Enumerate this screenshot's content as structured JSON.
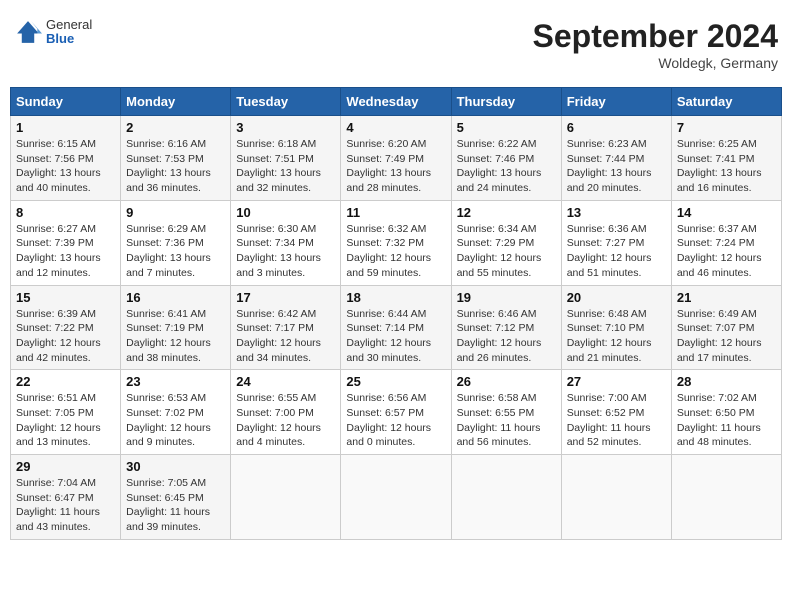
{
  "header": {
    "logo": {
      "general": "General",
      "blue": "Blue"
    },
    "title": "September 2024",
    "location": "Woldegk, Germany"
  },
  "columns": [
    "Sunday",
    "Monday",
    "Tuesday",
    "Wednesday",
    "Thursday",
    "Friday",
    "Saturday"
  ],
  "weeks": [
    [
      {
        "day": "1",
        "sunrise": "Sunrise: 6:15 AM",
        "sunset": "Sunset: 7:56 PM",
        "daylight": "Daylight: 13 hours and 40 minutes."
      },
      {
        "day": "2",
        "sunrise": "Sunrise: 6:16 AM",
        "sunset": "Sunset: 7:53 PM",
        "daylight": "Daylight: 13 hours and 36 minutes."
      },
      {
        "day": "3",
        "sunrise": "Sunrise: 6:18 AM",
        "sunset": "Sunset: 7:51 PM",
        "daylight": "Daylight: 13 hours and 32 minutes."
      },
      {
        "day": "4",
        "sunrise": "Sunrise: 6:20 AM",
        "sunset": "Sunset: 7:49 PM",
        "daylight": "Daylight: 13 hours and 28 minutes."
      },
      {
        "day": "5",
        "sunrise": "Sunrise: 6:22 AM",
        "sunset": "Sunset: 7:46 PM",
        "daylight": "Daylight: 13 hours and 24 minutes."
      },
      {
        "day": "6",
        "sunrise": "Sunrise: 6:23 AM",
        "sunset": "Sunset: 7:44 PM",
        "daylight": "Daylight: 13 hours and 20 minutes."
      },
      {
        "day": "7",
        "sunrise": "Sunrise: 6:25 AM",
        "sunset": "Sunset: 7:41 PM",
        "daylight": "Daylight: 13 hours and 16 minutes."
      }
    ],
    [
      {
        "day": "8",
        "sunrise": "Sunrise: 6:27 AM",
        "sunset": "Sunset: 7:39 PM",
        "daylight": "Daylight: 13 hours and 12 minutes."
      },
      {
        "day": "9",
        "sunrise": "Sunrise: 6:29 AM",
        "sunset": "Sunset: 7:36 PM",
        "daylight": "Daylight: 13 hours and 7 minutes."
      },
      {
        "day": "10",
        "sunrise": "Sunrise: 6:30 AM",
        "sunset": "Sunset: 7:34 PM",
        "daylight": "Daylight: 13 hours and 3 minutes."
      },
      {
        "day": "11",
        "sunrise": "Sunrise: 6:32 AM",
        "sunset": "Sunset: 7:32 PM",
        "daylight": "Daylight: 12 hours and 59 minutes."
      },
      {
        "day": "12",
        "sunrise": "Sunrise: 6:34 AM",
        "sunset": "Sunset: 7:29 PM",
        "daylight": "Daylight: 12 hours and 55 minutes."
      },
      {
        "day": "13",
        "sunrise": "Sunrise: 6:36 AM",
        "sunset": "Sunset: 7:27 PM",
        "daylight": "Daylight: 12 hours and 51 minutes."
      },
      {
        "day": "14",
        "sunrise": "Sunrise: 6:37 AM",
        "sunset": "Sunset: 7:24 PM",
        "daylight": "Daylight: 12 hours and 46 minutes."
      }
    ],
    [
      {
        "day": "15",
        "sunrise": "Sunrise: 6:39 AM",
        "sunset": "Sunset: 7:22 PM",
        "daylight": "Daylight: 12 hours and 42 minutes."
      },
      {
        "day": "16",
        "sunrise": "Sunrise: 6:41 AM",
        "sunset": "Sunset: 7:19 PM",
        "daylight": "Daylight: 12 hours and 38 minutes."
      },
      {
        "day": "17",
        "sunrise": "Sunrise: 6:42 AM",
        "sunset": "Sunset: 7:17 PM",
        "daylight": "Daylight: 12 hours and 34 minutes."
      },
      {
        "day": "18",
        "sunrise": "Sunrise: 6:44 AM",
        "sunset": "Sunset: 7:14 PM",
        "daylight": "Daylight: 12 hours and 30 minutes."
      },
      {
        "day": "19",
        "sunrise": "Sunrise: 6:46 AM",
        "sunset": "Sunset: 7:12 PM",
        "daylight": "Daylight: 12 hours and 26 minutes."
      },
      {
        "day": "20",
        "sunrise": "Sunrise: 6:48 AM",
        "sunset": "Sunset: 7:10 PM",
        "daylight": "Daylight: 12 hours and 21 minutes."
      },
      {
        "day": "21",
        "sunrise": "Sunrise: 6:49 AM",
        "sunset": "Sunset: 7:07 PM",
        "daylight": "Daylight: 12 hours and 17 minutes."
      }
    ],
    [
      {
        "day": "22",
        "sunrise": "Sunrise: 6:51 AM",
        "sunset": "Sunset: 7:05 PM",
        "daylight": "Daylight: 12 hours and 13 minutes."
      },
      {
        "day": "23",
        "sunrise": "Sunrise: 6:53 AM",
        "sunset": "Sunset: 7:02 PM",
        "daylight": "Daylight: 12 hours and 9 minutes."
      },
      {
        "day": "24",
        "sunrise": "Sunrise: 6:55 AM",
        "sunset": "Sunset: 7:00 PM",
        "daylight": "Daylight: 12 hours and 4 minutes."
      },
      {
        "day": "25",
        "sunrise": "Sunrise: 6:56 AM",
        "sunset": "Sunset: 6:57 PM",
        "daylight": "Daylight: 12 hours and 0 minutes."
      },
      {
        "day": "26",
        "sunrise": "Sunrise: 6:58 AM",
        "sunset": "Sunset: 6:55 PM",
        "daylight": "Daylight: 11 hours and 56 minutes."
      },
      {
        "day": "27",
        "sunrise": "Sunrise: 7:00 AM",
        "sunset": "Sunset: 6:52 PM",
        "daylight": "Daylight: 11 hours and 52 minutes."
      },
      {
        "day": "28",
        "sunrise": "Sunrise: 7:02 AM",
        "sunset": "Sunset: 6:50 PM",
        "daylight": "Daylight: 11 hours and 48 minutes."
      }
    ],
    [
      {
        "day": "29",
        "sunrise": "Sunrise: 7:04 AM",
        "sunset": "Sunset: 6:47 PM",
        "daylight": "Daylight: 11 hours and 43 minutes."
      },
      {
        "day": "30",
        "sunrise": "Sunrise: 7:05 AM",
        "sunset": "Sunset: 6:45 PM",
        "daylight": "Daylight: 11 hours and 39 minutes."
      },
      {
        "day": "",
        "sunrise": "",
        "sunset": "",
        "daylight": ""
      },
      {
        "day": "",
        "sunrise": "",
        "sunset": "",
        "daylight": ""
      },
      {
        "day": "",
        "sunrise": "",
        "sunset": "",
        "daylight": ""
      },
      {
        "day": "",
        "sunrise": "",
        "sunset": "",
        "daylight": ""
      },
      {
        "day": "",
        "sunrise": "",
        "sunset": "",
        "daylight": ""
      }
    ]
  ]
}
